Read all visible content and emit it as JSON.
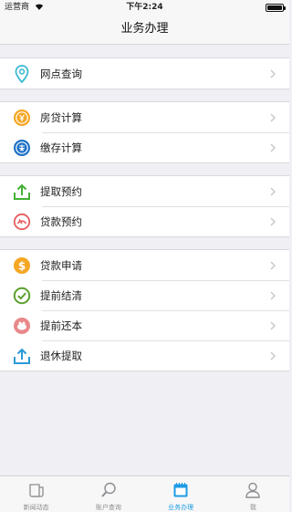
{
  "status_bar": {
    "carrier": "运营商",
    "time": "下午2:24"
  },
  "header": {
    "title": "业务办理"
  },
  "groups": [
    {
      "items": [
        {
          "label": "网点查询",
          "icon": "location-pin-icon",
          "color": "#3bbad0"
        }
      ]
    },
    {
      "items": [
        {
          "label": "房贷计算",
          "icon": "loan-calc-icon",
          "color": "#f5a623"
        },
        {
          "label": "缴存计算",
          "icon": "deposit-calc-icon",
          "color": "#1d70c6"
        }
      ]
    },
    {
      "items": [
        {
          "label": "提取预约",
          "icon": "upload-icon",
          "color": "#44b035"
        },
        {
          "label": "贷款预约",
          "icon": "gauge-icon",
          "color": "#e85c5c"
        }
      ]
    },
    {
      "items": [
        {
          "label": "贷款申请",
          "icon": "dollar-coin-icon",
          "color": "#f5a623"
        },
        {
          "label": "提前结清",
          "icon": "check-circle-icon",
          "color": "#5aa02c"
        },
        {
          "label": "提前还本",
          "icon": "piggy-bank-icon",
          "color": "#e9898a"
        },
        {
          "label": "退休提取",
          "icon": "share-out-icon",
          "color": "#2b9ad8"
        }
      ]
    }
  ],
  "tab_bar": {
    "tabs": [
      {
        "label": "新闻动态",
        "icon": "news-icon",
        "active": false
      },
      {
        "label": "账户查询",
        "icon": "magnifier-icon",
        "active": false
      },
      {
        "label": "业务办理",
        "icon": "calendar-icon",
        "active": true
      },
      {
        "label": "我",
        "icon": "person-icon",
        "active": false
      }
    ]
  },
  "colors": {
    "accent": "#1e9be4",
    "background": "#efeff4"
  }
}
